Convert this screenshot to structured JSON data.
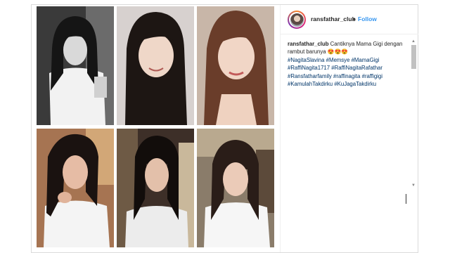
{
  "post": {
    "username": "ransfathar_club",
    "separator": "•",
    "follow_label": "Follow",
    "caption_user": "ransfathar_club",
    "caption_text": "Cantiknya Mama Gigi dengan rambut barunya 😍😍😍",
    "hashtags": [
      "#NagitaSlavina",
      "#Memsye",
      "#MamaGigi",
      "#RaffiNagita1717",
      "#RaffiNagitaRafathar",
      "#Ransfatharfamily",
      "#raffinagita",
      "#raffigigi",
      "#KamulahTakdirku",
      "#KuJagaTakdirku"
    ]
  },
  "colors": {
    "link": "#3897f0",
    "hashtag": "#003569",
    "border": "#dbdbdb"
  },
  "icons": [
    "avatar",
    "scroll-up-arrow-icon",
    "scroll-down-arrow-icon"
  ],
  "scrollbar": {
    "up": "▲",
    "down": "▼"
  }
}
